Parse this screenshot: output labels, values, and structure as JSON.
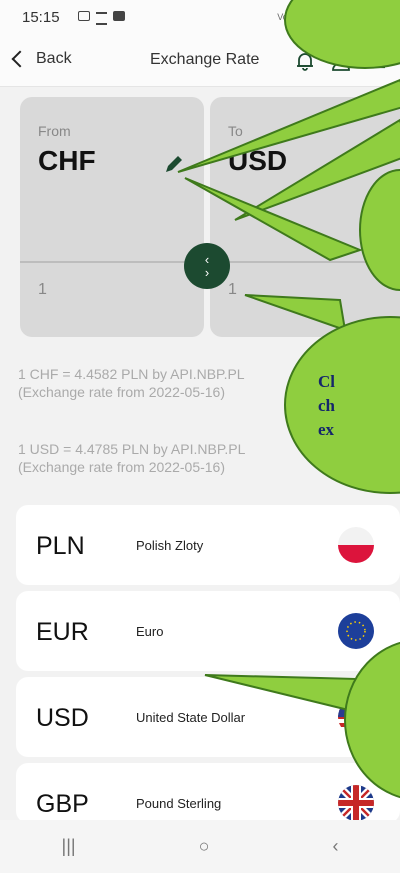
{
  "status_bar": {
    "time": "15:15",
    "network": "Vo8 LTE LTE1 ↓↑"
  },
  "nav": {
    "back_label": "Back",
    "title": "Exchange Rate",
    "icons": [
      "bell-icon",
      "user-icon",
      "menu-icon"
    ]
  },
  "converter": {
    "from": {
      "label": "From",
      "code": "CHF",
      "amount": "1"
    },
    "to": {
      "label": "To",
      "code": "USD",
      "amount": "1"
    },
    "swap_icons": [
      "‹",
      "›"
    ]
  },
  "rates": [
    {
      "line1": "1 CHF = 4.4582 PLN by API.NBP.PL",
      "line2": "(Exchange rate from 2022-05-16)"
    },
    {
      "line1": "1 USD = 4.4785 PLN by API.NBP.PL",
      "line2": "(Exchange rate from 2022-05-16)"
    }
  ],
  "currencies": [
    {
      "code": "PLN",
      "name": "Polish Zloty",
      "flag": "poland-flag-icon"
    },
    {
      "code": "EUR",
      "name": "Euro",
      "flag": "eu-flag-icon"
    },
    {
      "code": "USD",
      "name": "United State Dollar",
      "flag": "usa-flag-icon"
    },
    {
      "code": "GBP",
      "name": "Pound Sterling",
      "flag": "uk-flag-icon"
    }
  ],
  "callout": {
    "line1": "Cl",
    "line2": "ch",
    "line3": "ex"
  },
  "system_nav": {
    "recent": "|||",
    "home": "○",
    "back": "‹"
  },
  "colors": {
    "accent": "#1c4a30",
    "callout_fill": "#8fce3f",
    "callout_stroke": "#3f7a1c",
    "callout_text": "#15266b"
  }
}
